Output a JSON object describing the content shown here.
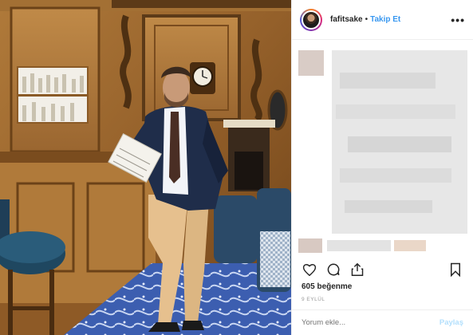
{
  "post": {
    "username": "fafitsake",
    "separator": "•",
    "follow_label": "Takip Et",
    "more_label": "•••",
    "likes": "605 beğenme",
    "date": "9 EYLÜL",
    "comment_placeholder": "Yorum ekle...",
    "share_label": "Paylaş"
  },
  "icons": {
    "like": "heart-icon",
    "comment": "comment-bubble-icon",
    "share": "share-upload-icon",
    "save": "bookmark-icon"
  },
  "colors": {
    "link_blue": "#3897f0",
    "disabled_blue": "#b2dffc",
    "text": "#262626",
    "muted": "#999999"
  }
}
